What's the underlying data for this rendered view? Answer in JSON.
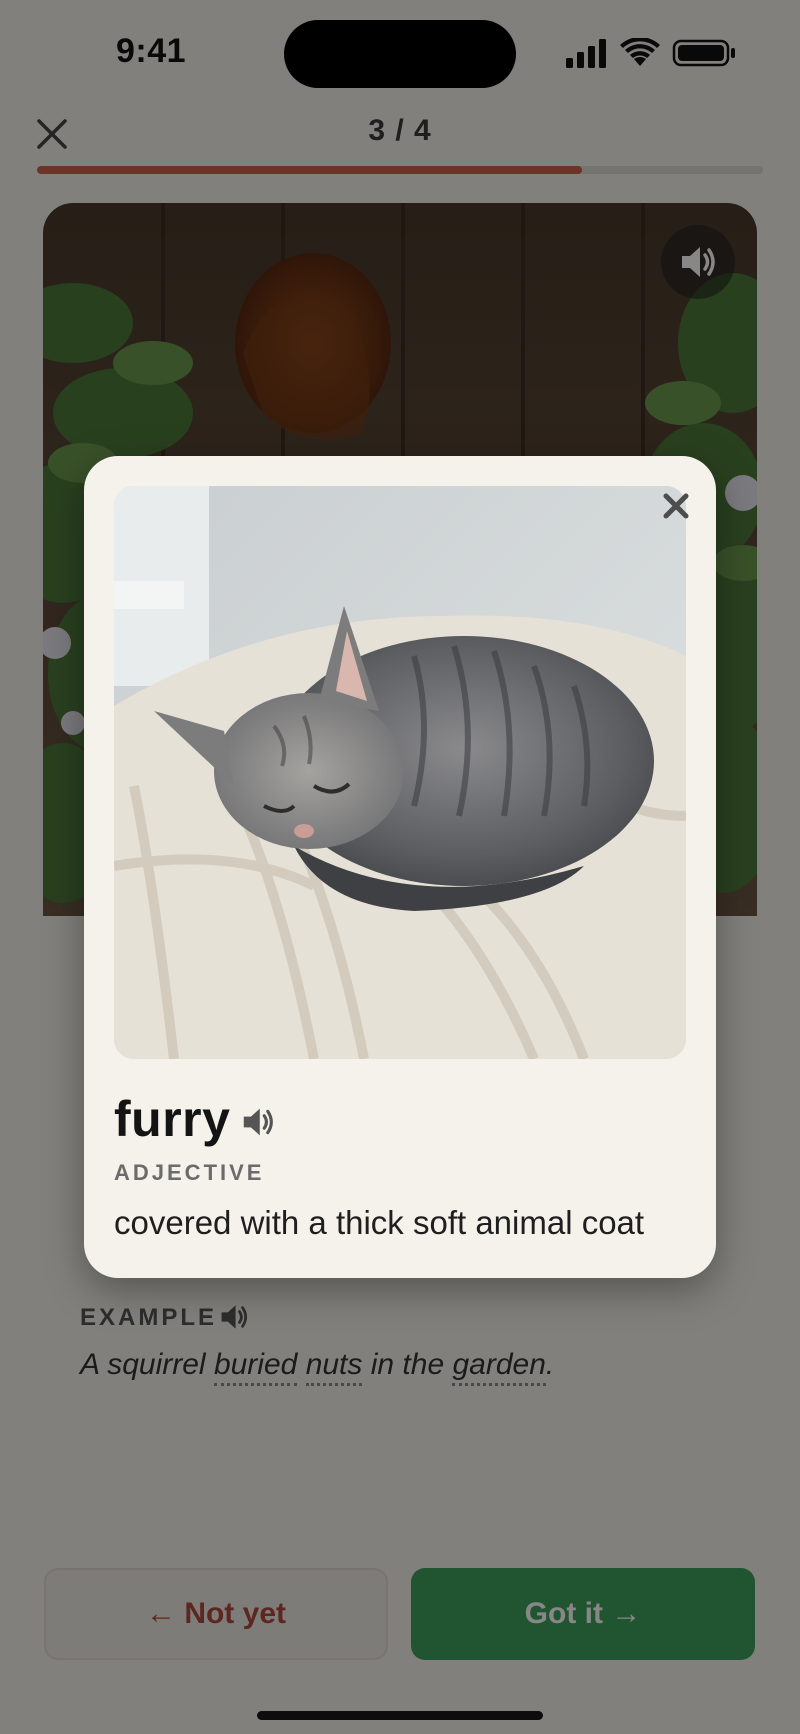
{
  "status_bar": {
    "time": "9:41"
  },
  "header": {
    "progress_text": "3 / 4",
    "progress_current": 3,
    "progress_total": 4,
    "progress_fraction": 0.75
  },
  "example": {
    "label": "EXAMPLE",
    "sentence_parts": [
      "A squirrel ",
      "buried",
      " ",
      "nuts",
      " in the ",
      "garden",
      "."
    ]
  },
  "buttons": {
    "not_yet": "← Not yet",
    "got_it": "Got it →"
  },
  "modal": {
    "word": "furry",
    "part_of_speech": "ADJECTIVE",
    "definition": "covered with a thick soft animal coat"
  },
  "colors": {
    "accent_progress": "#c9624b",
    "got_it_green": "#3f9f5c",
    "not_yet_red": "#b2483d",
    "card_background": "#f5f1eb"
  },
  "icons": {
    "close": "close-icon",
    "speaker": "speaker-icon",
    "signal": "cellular-signal-icon",
    "wifi": "wifi-icon",
    "battery": "battery-icon"
  }
}
